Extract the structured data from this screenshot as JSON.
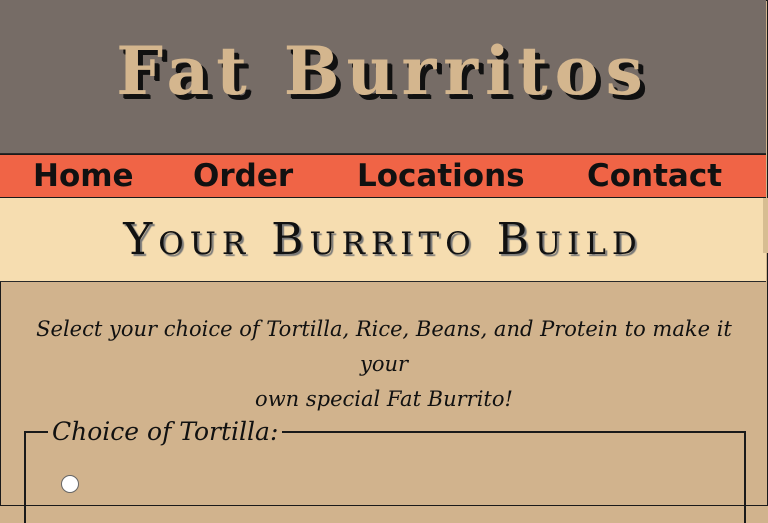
{
  "header": {
    "title": "Fat Burritos"
  },
  "nav": {
    "items": [
      {
        "label": "Home"
      },
      {
        "label": "Order"
      },
      {
        "label": "Locations"
      },
      {
        "label": "Contact"
      }
    ]
  },
  "banner": {
    "title": "Your Burrito Build"
  },
  "intro": {
    "line1": "Select your choice of Tortilla, Rice, Beans, and Protein to make it your",
    "line2": "own special Fat Burrito!"
  },
  "tortilla_section": {
    "legend": "Choice of Tortilla:"
  },
  "colors": {
    "header_bg": "#766c66",
    "title_color": "#d4b68e",
    "nav_bg": "#f06446",
    "banner_bg": "#f6ddb0",
    "page_bg": "#d1b38d"
  }
}
